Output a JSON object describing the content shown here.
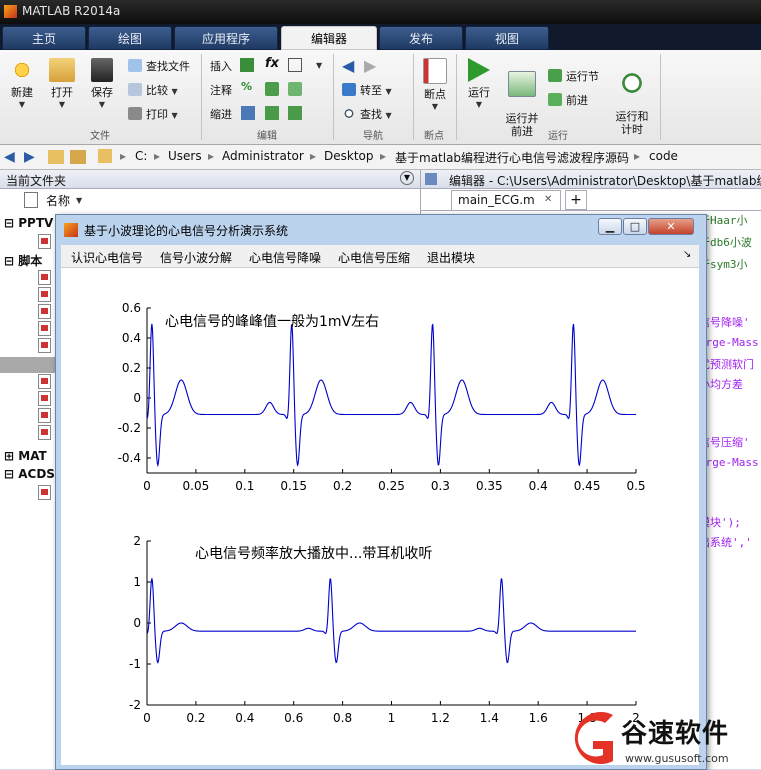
{
  "app": {
    "title": "MATLAB R2014a"
  },
  "ribbon_tabs": [
    {
      "label": "主页",
      "active": false
    },
    {
      "label": "绘图",
      "active": false
    },
    {
      "label": "应用程序",
      "active": false
    },
    {
      "label": "编辑器",
      "active": true
    },
    {
      "label": "发布",
      "active": false
    },
    {
      "label": "视图",
      "active": false
    }
  ],
  "ribbon": {
    "file": {
      "new": "新建",
      "open": "打开",
      "save": "保存",
      "find_files": "查找文件",
      "compare": "比较",
      "print": "打印",
      "group": "文件"
    },
    "edit": {
      "insert": "插入",
      "comment": "注释",
      "indent": "缩进",
      "fx": "fx",
      "group": "编辑"
    },
    "navigate": {
      "goto": "转至",
      "find": "查找",
      "group": "导航"
    },
    "breakpoints": {
      "label": "断点",
      "group": "断点"
    },
    "run": {
      "run": "运行",
      "run_advance": "运行并\n前进",
      "run_section": "运行节",
      "advance": "前进",
      "run_time": "运行和\n计时",
      "group": "运行"
    }
  },
  "address": {
    "crumbs": [
      "C:",
      "Users",
      "Administrator",
      "Desktop",
      "基于matlab编程进行心电信号滤波程序源码",
      "code"
    ]
  },
  "current_folder": {
    "title": "当前文件夹",
    "col_name": "名称",
    "groups": [
      {
        "label": "PPTV"
      },
      {
        "label": "脚本"
      },
      {
        "label": "MAT"
      },
      {
        "label": "ACDS"
      }
    ]
  },
  "editor": {
    "title": "编辑器 - C:\\Users\\Administrator\\Desktop\\基于matlab编",
    "tab": "main_ECG.m",
    "code_fragments": [
      "于Haar小",
      "于db6小波",
      "于sym3小",
      "信号降噪'",
      "irge-Mass",
      "优预测软门",
      "小均方差",
      "信号压缩'",
      "irge-Mass",
      "模块');",
      "出系统','"
    ]
  },
  "figure": {
    "title": "基于小波理论的心电信号分析演示系统",
    "menus": [
      "认识心电信号",
      "信号小波分解",
      "心电信号降噪",
      "心电信号压缩",
      "退出模块"
    ],
    "window_buttons": {
      "minimize": "▁",
      "maximize": "□",
      "close": "✕"
    }
  },
  "chart_data": [
    {
      "type": "line",
      "title": "",
      "annotation": "心电信号的峰峰值一般为1mV左右",
      "xlabel": "",
      "ylabel": "",
      "xlim": [
        0,
        0.5
      ],
      "ylim": [
        -0.5,
        0.6
      ],
      "xticks": [
        "0",
        "0.05",
        "0.1",
        "0.15",
        "0.2",
        "0.25",
        "0.3",
        "0.35",
        "0.4",
        "0.45",
        "0.5"
      ],
      "yticks": [
        "0.6",
        "0.4",
        "0.2",
        "0",
        "-0.2",
        "-0.4"
      ],
      "color": "#0000cc",
      "beat_R_times": [
        0.005,
        0.148,
        0.292,
        0.436
      ],
      "beat_R_peak": 0.5,
      "beat_S_trough": -0.45,
      "baseline": -0.11,
      "T_peak": 0.12
    },
    {
      "type": "line",
      "title": "",
      "annotation": "心电信号频率放大播放中...带耳机收听",
      "xlabel": "",
      "ylabel": "",
      "xlim": [
        0,
        2
      ],
      "ylim": [
        -2,
        2
      ],
      "xticks": [
        "0",
        "0.2",
        "0.4",
        "0.6",
        "0.8",
        "1",
        "1.2",
        "1.4",
        "1.6",
        "1.8",
        "2"
      ],
      "yticks": [
        "2",
        "1",
        "0",
        "-1",
        "-2"
      ],
      "color": "#0000cc",
      "beat_R_times": [
        0.02,
        0.75,
        1.45
      ],
      "beat_R_peak": 1.1,
      "beat_S_trough": -0.97,
      "baseline": -0.2,
      "T_peak": 0.0
    }
  ],
  "watermark": {
    "brand": "谷速软件",
    "url": "www.gususoft.com"
  }
}
